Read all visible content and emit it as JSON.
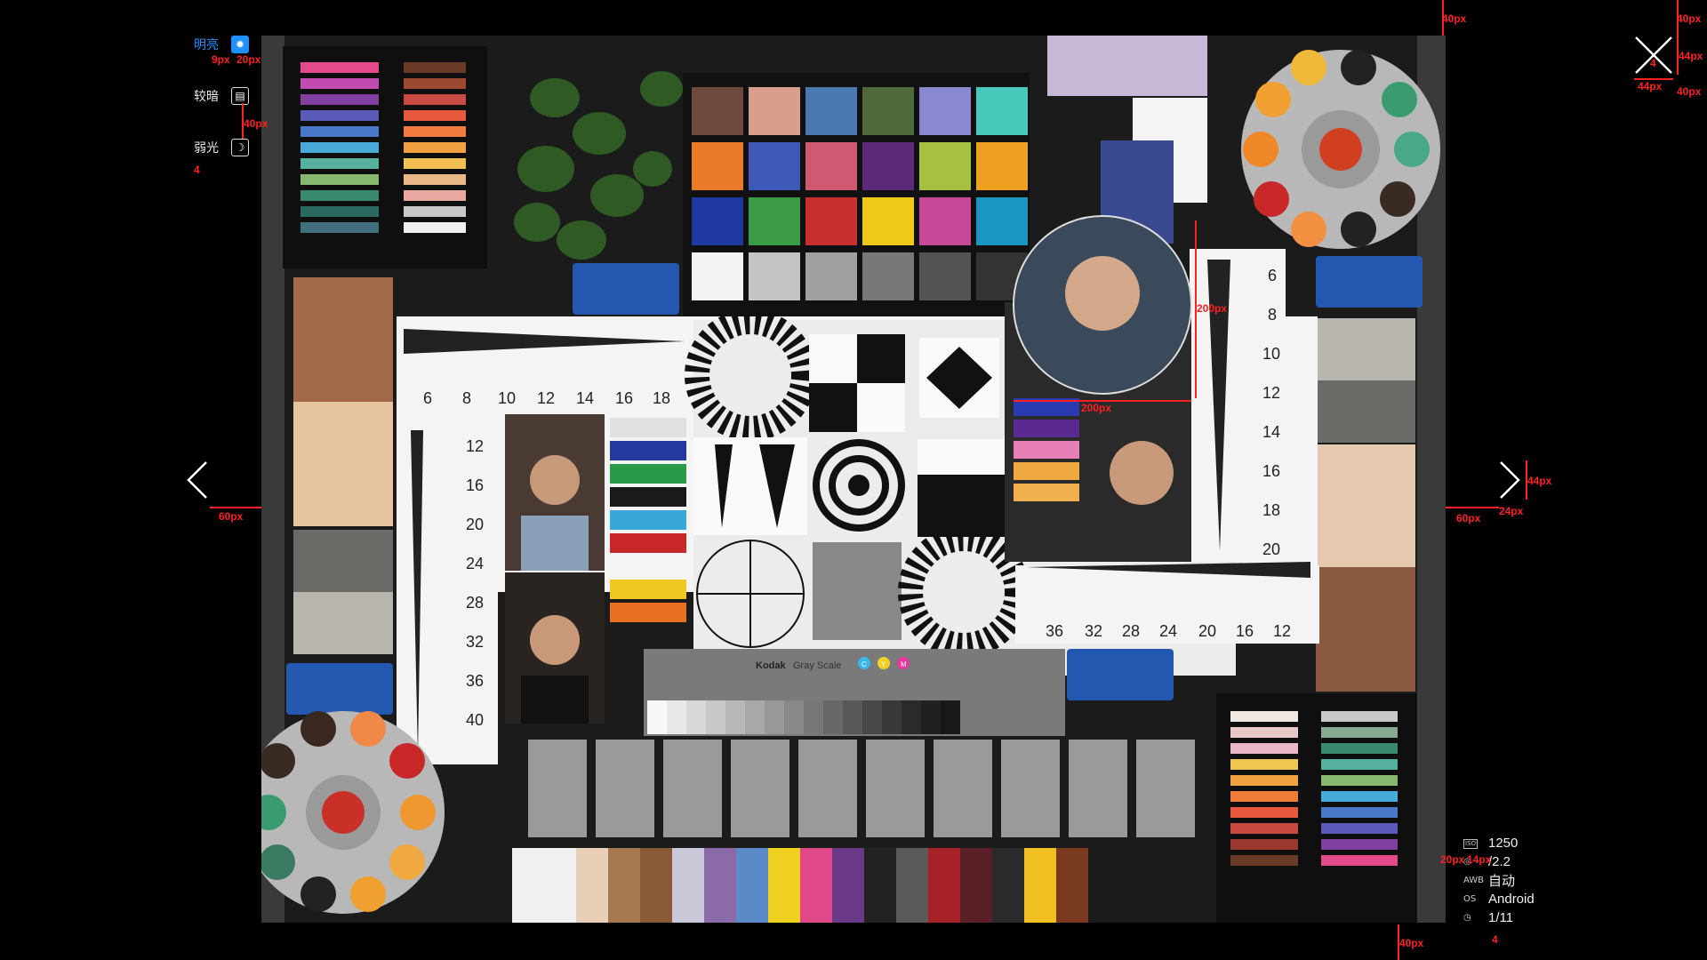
{
  "modes": [
    {
      "label": "明亮",
      "icon": "sun-icon",
      "active": true
    },
    {
      "label": "较暗",
      "icon": "keyboard-icon",
      "active": false
    },
    {
      "label": "弱光",
      "icon": "moon-icon",
      "active": false
    }
  ],
  "exif": [
    {
      "icon": "iso-icon",
      "value": "1250"
    },
    {
      "icon": "aperture-icon",
      "value": "/2.2"
    },
    {
      "key": "AWB",
      "value": "自动"
    },
    {
      "key": "OS",
      "value": "Android"
    },
    {
      "icon": "clock-icon",
      "value": "1/11"
    }
  ],
  "chart_ticks": {
    "top_ruler": [
      "6",
      "8",
      "10",
      "12",
      "14",
      "16",
      "18"
    ],
    "left_ruler": [
      "12",
      "16",
      "20",
      "24",
      "28",
      "32",
      "36",
      "40"
    ],
    "right_ruler": [
      "6",
      "8",
      "10",
      "12",
      "14",
      "16",
      "18",
      "20"
    ],
    "bottom_ruler": [
      "36",
      "32",
      "28",
      "24",
      "20",
      "16",
      "12"
    ]
  },
  "kodak": {
    "brand": "Kodak",
    "name": "Gray Scale",
    "letters": [
      "C",
      "Y",
      "M"
    ]
  },
  "annotations": {
    "a1": "40px",
    "a2": "40px",
    "a3": "44px",
    "a4": "40px",
    "a5": "44px",
    "a6": "4",
    "a7": "9px",
    "a8": "20px",
    "a9": "40px",
    "a10": "4",
    "a11": "200px",
    "a12": "200px",
    "a13": "60px",
    "a14": "44px",
    "a15": "60px",
    "a16": "24px",
    "a17": "20px",
    "a18": "14px",
    "a19": "40px",
    "a20": "4"
  }
}
